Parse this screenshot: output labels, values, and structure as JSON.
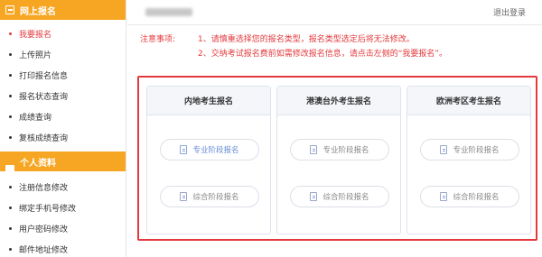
{
  "sidebar": {
    "section1": {
      "title": "网上报名",
      "icon": "edit-icon"
    },
    "items1": [
      {
        "label": "我要报名",
        "active": true
      },
      {
        "label": "上传照片"
      },
      {
        "label": "打印报名信息"
      },
      {
        "label": "报名状态查询"
      },
      {
        "label": "成绩查询"
      },
      {
        "label": "复核成绩查询"
      }
    ],
    "section2": {
      "title": "个人资料",
      "icon": "id-card-icon"
    },
    "items2": [
      {
        "label": "注册信息修改"
      },
      {
        "label": "绑定手机号修改"
      },
      {
        "label": "用户密码修改"
      },
      {
        "label": "邮件地址修改"
      }
    ]
  },
  "header": {
    "logout": "退出登录"
  },
  "notice": {
    "label": "注意事项:",
    "line1": "1、请慎重选择您的报名类型，报名类型选定后将无法修改。",
    "line2": "2、交纳考试报名费前如需修改报名信息，请点击左侧的“我要报名”。"
  },
  "cards": [
    {
      "title": "内地考生报名",
      "btn1": "专业阶段报名",
      "btn2": "综合阶段报名"
    },
    {
      "title": "港澳台外考生报名",
      "btn1": "专业阶段报名",
      "btn2": "综合阶段报名"
    },
    {
      "title": "欧洲考区考生报名",
      "btn1": "专业阶段报名",
      "btn2": "综合阶段报名"
    }
  ],
  "colors": {
    "accent": "#f6a623",
    "alert": "#e4393c",
    "link": "#6a8fd6"
  }
}
